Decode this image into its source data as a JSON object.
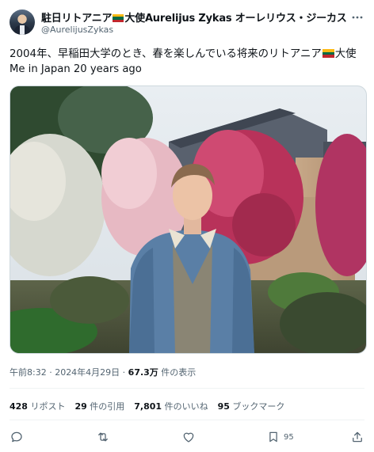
{
  "author": {
    "name_part1": "駐日リトアニア",
    "name_part2": "大使Aurelijus Zykas オーレリウス・ジーカス",
    "handle": "@AurelijusZykas"
  },
  "tweet": {
    "text_part1": "2004年、早稲田大学のとき、春を楽しんでいる将来のリトアニア",
    "text_part2": "大使",
    "translation": "Me in Japan 20 years ago"
  },
  "meta": {
    "timestamp": "午前8:32 · 2024年4月29日 · ",
    "views_count": "67.3万",
    "views_label": " 件の表示"
  },
  "stats": {
    "reposts_count": "428",
    "reposts_label": "リポスト",
    "quotes_count": "29",
    "quotes_label": "件の引用",
    "likes_count": "7,801",
    "likes_label": "件のいいね",
    "bookmarks_count": "95",
    "bookmarks_label": "ブックマーク"
  },
  "actions": {
    "bookmark_count": "95"
  },
  "colors": {
    "text": "#0f1419",
    "secondary": "#536471",
    "divider": "#eff3f4",
    "flag_yellow": "#fdb913",
    "flag_green": "#006a44",
    "flag_red": "#c1272d"
  }
}
